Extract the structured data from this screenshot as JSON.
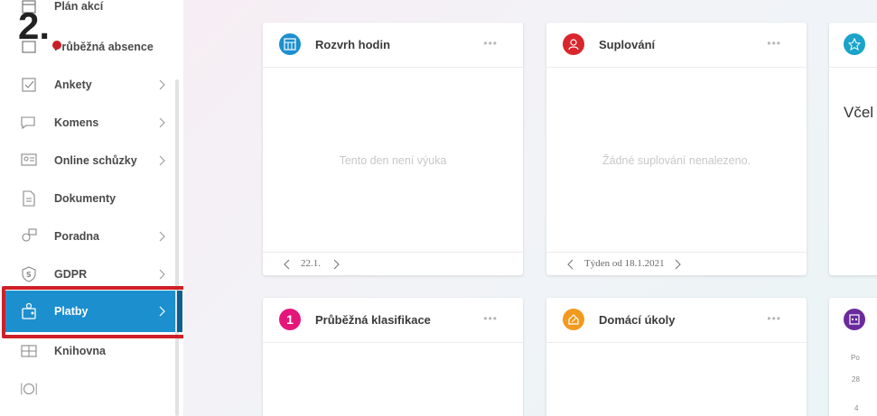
{
  "sidebar": {
    "items": [
      {
        "label": "Plán akcí",
        "icon": "calendar-icon"
      },
      {
        "label": "Průběžná absence",
        "icon": "absence-icon"
      },
      {
        "label": "Ankety",
        "icon": "checkbox-icon"
      },
      {
        "label": "Komens",
        "icon": "message-icon"
      },
      {
        "label": "Online schůzky",
        "icon": "video-meeting-icon"
      },
      {
        "label": "Dokumenty",
        "icon": "document-icon"
      },
      {
        "label": "Poradna",
        "icon": "advice-icon"
      },
      {
        "label": "GDPR",
        "icon": "shield-icon"
      },
      {
        "label": "Platby",
        "icon": "wallet-icon"
      },
      {
        "label": "Knihovna",
        "icon": "library-icon"
      },
      {
        "label": "",
        "icon": "food-icon"
      }
    ],
    "active_label": "Platby",
    "accent": "#1c8fcf",
    "highlight_color": "#cf2027"
  },
  "annotation": {
    "step_number": "2."
  },
  "cards": {
    "rozvrh": {
      "title": "Rozvrh hodin",
      "empty": "Tento den není výuka",
      "footer": "22.1.",
      "icon_color": "#1c8fcf"
    },
    "suplovani": {
      "title": "Suplování",
      "empty": "Žádné suplování nenalezeno.",
      "footer": "Týden od 18.1.2021",
      "icon_color": "#d9262c"
    },
    "vcel": {
      "partial_text": "Včel",
      "icon_color": "#1ba3c9"
    },
    "klasifikace": {
      "title": "Průběžná klasifikace",
      "icon_text": "1",
      "icon_color": "#e5167a"
    },
    "ukoly": {
      "title": "Domácí úkoly",
      "icon_color": "#f29a1f"
    },
    "kalendar": {
      "day_label": "Po",
      "dates": [
        "28",
        "4"
      ],
      "icon_color": "#6a2a9c"
    }
  },
  "menu_dots": "•••"
}
